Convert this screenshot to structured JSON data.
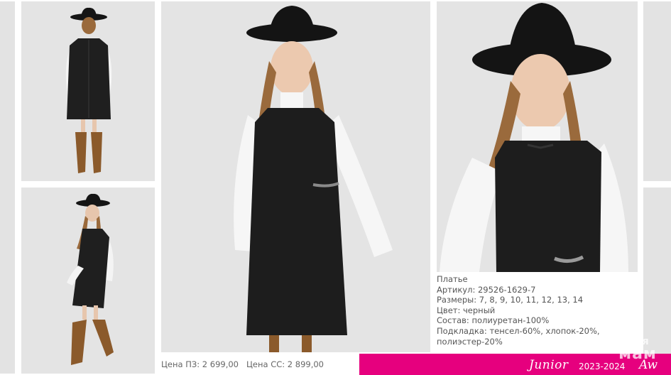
{
  "product": {
    "name": "Платье",
    "article": "Артикул: 29526-1629-7",
    "sizes": "Размеры: 7, 8, 9, 10, 11, 12, 13, 14",
    "color": "Цвет: черный",
    "composition": "Состав: полиуретан-100%",
    "lining_line1": "Подкладка: тенсел-60%, хлопок-20%,",
    "lining_line2": "полиэстер-20%"
  },
  "prices": {
    "price_pz": "Цена ПЗ: 2 699,00",
    "price_ss": "Цена СС:  2 899,00"
  },
  "footer": {
    "brand": "Junior",
    "season": "2023-2024",
    "brand_suffix": "Aw",
    "accent_color": "#e6007e"
  },
  "watermark": {
    "line1": "для",
    "line2": "мам"
  },
  "photos": [
    {
      "view": "back"
    },
    {
      "view": "side-walking"
    },
    {
      "view": "front-full"
    },
    {
      "view": "close-up"
    }
  ]
}
